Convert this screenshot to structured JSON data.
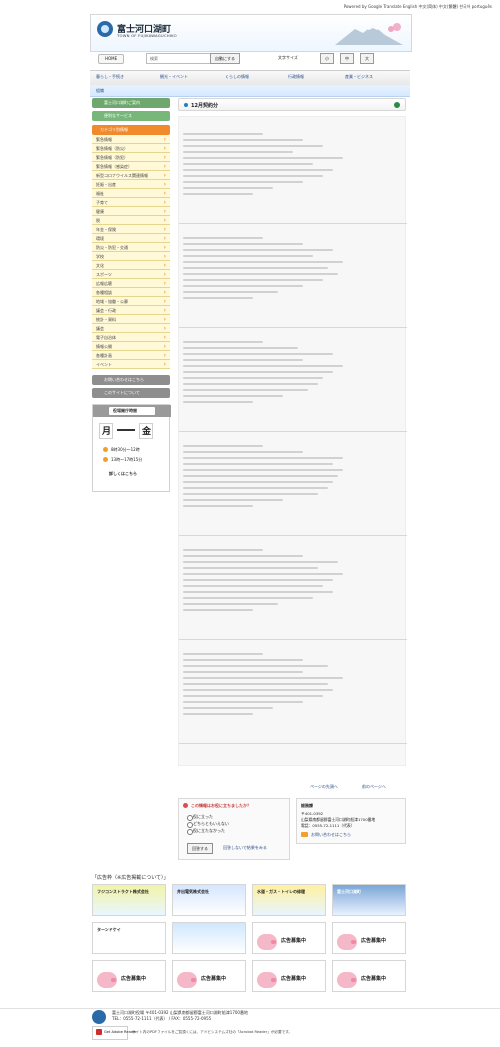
{
  "header": {
    "powered_by": "Powered by Google Translate English 中文(简体) 中文(繁體) 한국어 português",
    "town_jp": "富士河口湖町",
    "town_en": "TOWN OF FUJIKAWAGUCHIKO"
  },
  "nav": {
    "home": "HOME",
    "search_placeholder": "検索",
    "search_button": "自動にする",
    "font_size": "文字サイズ",
    "font_small": "小",
    "font_medium": "中",
    "font_large": "大"
  },
  "tabs": {
    "row1": [
      "暮らし・手続き",
      "観光・イベント",
      "くらしの情報",
      "行政情報",
      "産業・ビジネス"
    ],
    "row2": "組織"
  },
  "sidebar": {
    "top_items": [
      "富士河口湖町ご案内",
      "便利なサービス"
    ],
    "category_header": "カテゴリ別情報",
    "items": [
      "緊急情報",
      "緊急情報（防災）",
      "緊急情報（防犯）",
      "緊急情報（感染症）",
      "新型コロナウイルス関連情報",
      "妊娠・出産",
      "福祉",
      "子育て",
      "健康",
      "税",
      "年金・保険",
      "環境",
      "防災・防犯・交通",
      "学校",
      "文化",
      "スポーツ",
      "広報広聴",
      "各種相談",
      "地域・協働・公募",
      "議会・行政",
      "統計・資料",
      "議会",
      "電子自治体",
      "情報公開",
      "各種計画",
      "イベント"
    ],
    "gray_items": [
      "お問い合わせはこちら",
      "このサイトについて"
    ],
    "hours": {
      "title": "役場開庁時間",
      "day_from": "月",
      "day_to": "金",
      "time1": "8時30分〜12時",
      "time2": "13時〜17時15分",
      "details": "詳しくはこちら"
    }
  },
  "content": {
    "title": "12月契約分",
    "entries_count_visible": 7
  },
  "pager": {
    "prev": "ページの先頭へ",
    "next": "前のページへ"
  },
  "feedback": {
    "question": "この情報はお役に立ちましたか？",
    "options": [
      "役に立った",
      "どちらともいえない",
      "役に立たなかった"
    ],
    "send_button": "回答する",
    "note": "回答しないで結果をみる",
    "contact_title": "総務課",
    "contact_lines": [
      "〒401-0392",
      "山梨県南都留郡富士河口湖町船津1700番地",
      "電話：0555-72-1111（代表）"
    ],
    "contact_link": "お問い合わせはこちら"
  },
  "ads": {
    "title": "「広告枠（※広告掲載について）」",
    "tiles": [
      "フジコンストラクト株式会社",
      "井出電気株式会社",
      "水道・ガス・トイレの修理",
      "富士河口湖町",
      "ターンドケイ",
      "",
      "広告募集中",
      "広告募集中",
      "広告募集中",
      "広告募集中",
      "広告募集中",
      "広告募集中"
    ]
  },
  "footer": {
    "line1": "富士河口湖町役場 〒401-0392 山梨県南都留郡富士河口湖町船津1700番地",
    "line2": "TEL：0555-72-1111（代表） / FAX：0555-72-0955",
    "reader": "Get Adobe Reader",
    "reader_note": "サイト内のPDFファイルをご覧頂くには、アドビシステムズ社の「Acrobat Reader」が必要です。"
  }
}
